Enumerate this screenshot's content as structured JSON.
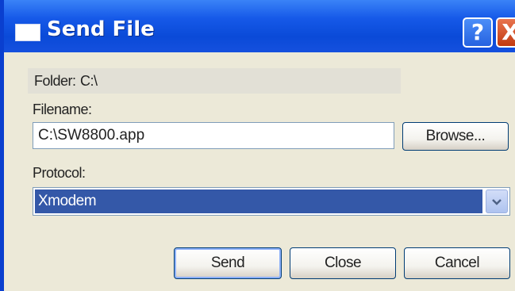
{
  "window": {
    "title": "Send File",
    "help_label": "?",
    "close_label": "X"
  },
  "folder": {
    "label": "Folder:",
    "value": "C:\\"
  },
  "filename": {
    "label": "Filename:",
    "value": "C:\\SW8800.app"
  },
  "browse_label": "Browse...",
  "protocol": {
    "label": "Protocol:",
    "selected": "Xmodem"
  },
  "buttons": {
    "send": "Send",
    "close": "Close",
    "cancel": "Cancel"
  },
  "colors": {
    "titlebar": "#0a4ad8",
    "dialog_bg": "#ece9d8",
    "selection": "#3458a8",
    "close_button": "#c23a10"
  },
  "icons": [
    "window-icon",
    "help-icon",
    "close-icon",
    "chevron-down-icon"
  ]
}
